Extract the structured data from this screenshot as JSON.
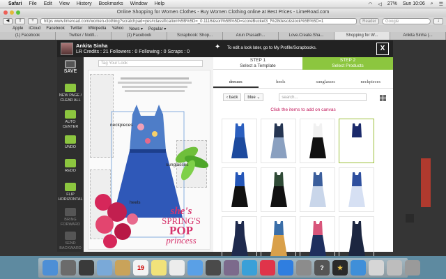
{
  "os": {
    "menubar": [
      "Safari",
      "File",
      "Edit",
      "View",
      "History",
      "Bookmarks",
      "Window",
      "Help"
    ],
    "battery": "27%",
    "clock": "Sun 10:06"
  },
  "browser": {
    "window_title": "Online Shopping for Women Clothes - Buy Women Clothing online at Best Prices - LimeRoad.com",
    "url": "https  www.limeroad.com/women-clothing?scratchpad=yes#classification%5B%5D=_0.1116&sort%5B%5D=scoreBucket3_f%28desc&stock%5B%5D=1",
    "reader_label": "Reader",
    "google_placeholder": "Google",
    "bookmarks": [
      "Apple",
      "iCloud",
      "Facebook",
      "Twitter",
      "Wikipedia",
      "Yahoo",
      "News ▾",
      "Popular ▾"
    ],
    "tabs": [
      "(1) Facebook",
      "Twitter / Notifi...",
      "(1) Facebook",
      "Scrapbook: Shop...",
      "Arun Prasadh...",
      "Love.Create.Sha...",
      "Shopping for W...",
      "Ankita Sinha (..."
    ]
  },
  "modal": {
    "user_name": "Ankita Sinha",
    "user_stats": "LR Credits : 21    Followers : 0    Following : 0    Scraps : 0",
    "tip": "To edit a look later, go to My Profile/Scrapbooks.",
    "close": "X",
    "left_tools": [
      {
        "label": "SAVE",
        "enabled": true
      },
      {
        "label": "NEW PAGE / CLEAR ALL",
        "enabled": true
      },
      {
        "label": "AUTO CENTER",
        "enabled": true
      },
      {
        "label": "UNDO",
        "enabled": true
      },
      {
        "label": "REDO",
        "enabled": true
      },
      {
        "label": "FLIP HORIZONTAL",
        "enabled": true
      },
      {
        "label": "BRING FORWARD",
        "enabled": false
      },
      {
        "label": "SEND BACKWARD",
        "enabled": false
      }
    ],
    "tag_placeholder": "Tag Your Look",
    "canvas": {
      "labels": {
        "neckpieces": "neckpieces",
        "sunglasses": "sunglasses",
        "heels": "heels"
      },
      "poster": {
        "line1": "she's",
        "line2": "SPRING'S",
        "line3": "POP",
        "line4": "princess"
      }
    },
    "steps": [
      {
        "title": "STEP 1",
        "subtitle": "Select a Template",
        "active": false
      },
      {
        "title": "STEP 2",
        "subtitle": "Select Products",
        "active": true
      }
    ],
    "product_tabs": [
      "dresses",
      "heels",
      "sunglasses",
      "neckpieces"
    ],
    "back_label": "‹ back",
    "color_filter": "blue ⌄",
    "search_placeholder": "search...",
    "hint": "Click the items to add on canvas",
    "colors": {
      "step_active": "#8cc63f",
      "hint": "#c2185b",
      "poster": "#d6336c"
    },
    "products": [
      {
        "name": "royal-blue-shift-dress",
        "colors": [
          "#2b5fbf",
          "#1d4a9e"
        ]
      },
      {
        "name": "navy-lace-yoke-dress",
        "colors": [
          "#253552",
          "#8aa0c0"
        ]
      },
      {
        "name": "white-black-skater-dress",
        "colors": [
          "#f1f1f1",
          "#111111"
        ]
      },
      {
        "name": "striped-navy-dress",
        "colors": [
          "#1b2a6b",
          "#ffffff"
        ],
        "selected": true
      },
      {
        "name": "blue-black-panel-dress",
        "colors": [
          "#2456b8",
          "#111111"
        ]
      },
      {
        "name": "green-black-print-maxi",
        "colors": [
          "#2f4a36",
          "#111111"
        ]
      },
      {
        "name": "blue-ikat-print-dress",
        "colors": [
          "#3b5e9c",
          "#c9d6ea"
        ]
      },
      {
        "name": "blue-floral-skater-dress",
        "colors": [
          "#2e4f9e",
          "#d6e0f3"
        ]
      },
      {
        "name": "navy-peter-pan-dress",
        "colors": [
          "#1f2a4d",
          "#1f2a4d"
        ]
      },
      {
        "name": "multicolor-print-dress",
        "colors": [
          "#3a6ea8",
          "#d9a04a"
        ]
      },
      {
        "name": "pink-blue-floral-dress",
        "colors": [
          "#d8557a",
          "#1e2f5e"
        ]
      },
      {
        "name": "navy-pleated-midi",
        "colors": [
          "#1c2640",
          "#1c2640"
        ]
      }
    ]
  }
}
